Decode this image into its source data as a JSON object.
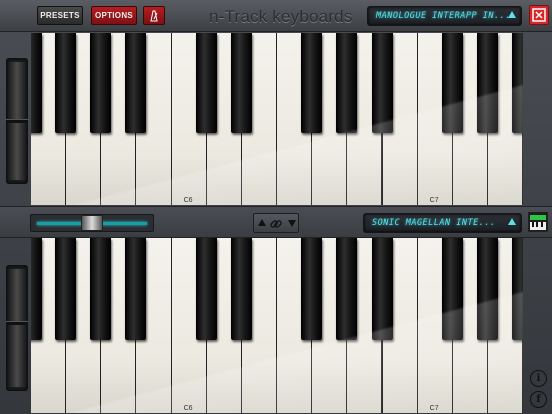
{
  "toolbar": {
    "presets_label": "PRESETS",
    "options_label": "OPTIONS",
    "metronome_icon": "metronome-icon",
    "app_title": "n-Track keyboards",
    "top_instrument": "MANOLOGUE INTERAPP IN...",
    "close_icon": "close-icon"
  },
  "middle": {
    "bottom_instrument": "SONIC MAGELLAN INTE...",
    "slider_value": 0.5,
    "link_icon": "link-icon",
    "keyboard_icon": "keyboard-icon"
  },
  "top_keyboard": {
    "c_labels": [
      "C6",
      "C7"
    ]
  },
  "bottom_keyboard": {
    "c_labels": [
      "C6",
      "C7"
    ]
  },
  "footer": {
    "info_label": "i",
    "facebook_label": "f"
  },
  "colors": {
    "accent_red": "#b41e22",
    "lcd_cyan": "#5fe0e8"
  }
}
